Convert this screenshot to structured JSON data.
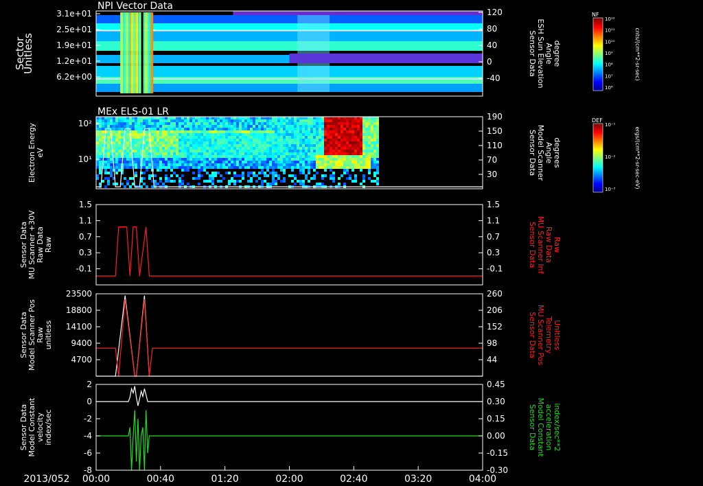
{
  "date_label": "2013/052",
  "colors": {
    "background": "#000000",
    "axis": "#ffffff",
    "red": "#ff2020",
    "green": "#22dd22"
  },
  "time_axis": {
    "start": "00:00",
    "end": "04:00",
    "ticks": [
      "00:00",
      "00:40",
      "01:20",
      "02:00",
      "02:40",
      "03:20",
      "04:00"
    ]
  },
  "panels": [
    {
      "id": "npi",
      "title": "NPI Vector Data",
      "left_label": [
        "Sector",
        "Unitless"
      ],
      "left_ticks": [
        "3.1e+01",
        "2.5e+01",
        "1.9e+01",
        "1.2e+01",
        "6.2e+00"
      ],
      "right_label": [
        "Sensor Data",
        "ESH Sun Elevation",
        "Angle",
        "degree"
      ],
      "right_ticks": [
        "120",
        "80",
        "40",
        "0",
        "-40"
      ],
      "colorbar": {
        "tag": "NF",
        "unit": "cnts/(cm**2-sr-sec)",
        "ticks": [
          "10¹²",
          "10¹¹",
          "10¹⁰",
          "10⁹",
          "10⁸",
          "10⁷",
          "10⁶"
        ]
      }
    },
    {
      "id": "els",
      "title": "MEx ELS-01 LR",
      "left_label": [
        "Electron Energy",
        "eV"
      ],
      "left_ticks": [
        "10²",
        "10¹"
      ],
      "right_label": [
        "Sensor Data",
        "Model Scanner",
        "Angle",
        "degrees"
      ],
      "right_ticks": [
        "190",
        "150",
        "110",
        "70",
        "30"
      ],
      "colorbar": {
        "tag": "DEF",
        "unit": "ergs/(cm**2-sr-sec-eV)",
        "ticks": [
          "10⁻¹",
          "10⁻²",
          "10⁻³"
        ]
      }
    },
    {
      "id": "raw",
      "left_label": [
        "Sensor Data",
        "MU Scanner +30V",
        "Raw Data",
        "Raw"
      ],
      "left_ticks": [
        "1.5",
        "1.1",
        "0.7",
        "0.3",
        "-0.1"
      ],
      "right_label": [
        "Sensor Data",
        "MU Scanner Inf",
        "Raw Data",
        "Raw"
      ],
      "right_ticks": [
        "1.5",
        "1.1",
        "0.7",
        "0.3",
        "-0.1"
      ]
    },
    {
      "id": "pos",
      "left_label": [
        "Sensor Data",
        "Model Scanner Pos",
        "Raw",
        "unitless"
      ],
      "left_ticks": [
        "23500",
        "18800",
        "14100",
        "9400",
        "4700"
      ],
      "right_label": [
        "Sensor Data",
        "MU Scanner Pos",
        "Telemetry",
        "Unitless"
      ],
      "right_ticks": [
        "260",
        "206",
        "152",
        "98",
        "44"
      ]
    },
    {
      "id": "vel",
      "left_label": [
        "Sensor Data",
        "Model Constant",
        "velocity",
        "index/sec"
      ],
      "left_ticks": [
        "2",
        "0",
        "-2",
        "-4",
        "-6",
        "-8"
      ],
      "right_label": [
        "Sensor Data",
        "Model Constant",
        "acceleration",
        "index/sec**2"
      ],
      "right_ticks": [
        "0.45",
        "0.30",
        "0.15",
        "0.00",
        "-0.15",
        "-0.30"
      ]
    }
  ],
  "chart_data": [
    {
      "type": "heatmap",
      "title": "NPI Vector Data",
      "ylabel": "Sector Unitless",
      "y2label": "Sensor Data ESH Sun Elevation Angle degree",
      "x_range": [
        "00:00",
        "04:00"
      ],
      "y_ticks": [
        31,
        25,
        19,
        12,
        6.2
      ],
      "y2_ticks": [
        120,
        80,
        40,
        0,
        -40
      ],
      "colorbar_label": "cnts/(cm**2-sr-sec)",
      "colorbar_range": [
        1000000.0,
        1000000000000.0
      ]
    },
    {
      "type": "heatmap",
      "title": "MEx ELS-01 LR",
      "ylabel": "Electron Energy eV",
      "y2label": "Sensor Data Model Scanner Angle degrees",
      "x_range": [
        "00:00",
        "04:00"
      ],
      "y_scale": "log",
      "colorbar_label": "ergs/(cm**2-sr-sec-eV)",
      "colorbar_range": [
        0.001,
        0.1
      ],
      "angle_trace": {
        "x_min": [
          0,
          3,
          6,
          9,
          12,
          15,
          18,
          21,
          24,
          27,
          30,
          33,
          36,
          60,
          120,
          180,
          240
        ],
        "y": [
          15,
          15,
          160,
          160,
          15,
          15,
          160,
          160,
          15,
          15,
          160,
          160,
          15,
          15,
          15,
          15,
          15
        ]
      }
    },
    {
      "type": "line",
      "ylabel": "Sensor Data MU Scanner +30V Raw Data Raw",
      "y2label": "Sensor Data MU Scanner Inf Raw Data Raw",
      "ylim": [
        -0.3,
        1.5
      ],
      "series": [
        {
          "color": "#ff2020",
          "x_min": [
            0,
            12,
            14,
            19,
            21,
            23,
            25,
            27,
            31,
            33,
            240
          ],
          "y": [
            -0.1,
            -0.1,
            1.0,
            1.0,
            -0.1,
            1.0,
            1.0,
            -0.1,
            1.0,
            -0.1,
            -0.1
          ]
        }
      ]
    },
    {
      "type": "line",
      "ylabel": "Sensor Data Model Scanner Pos Raw unitless",
      "y2label": "Sensor Data MU Scanner Pos Telemetry Unitless",
      "ylim": [
        0,
        23500
      ],
      "series": [
        {
          "color": "#ffffff",
          "x_min": [
            0,
            12,
            18,
            24,
            25,
            30,
            33,
            240
          ],
          "y": [
            0,
            0,
            23000,
            0,
            0,
            23000,
            0,
            0
          ]
        },
        {
          "color": "#ff2020",
          "x_min": [
            0,
            12,
            14,
            18,
            24,
            25,
            30,
            33,
            35,
            240
          ],
          "y": [
            8000,
            8000,
            0,
            22000,
            0,
            0,
            22000,
            0,
            8000,
            8000
          ]
        }
      ]
    },
    {
      "type": "line",
      "ylabel": "Sensor Data Model Constant velocity index/sec",
      "y2label": "Sensor Data Model Constant acceleration index/sec**2",
      "ylim": [
        -8,
        2
      ],
      "y2lim": [
        -0.3,
        0.45
      ],
      "series": [
        {
          "color": "#ffffff",
          "x_min": [
            0,
            20,
            21,
            22,
            23,
            24,
            25,
            26,
            27,
            28,
            29,
            30,
            31,
            32,
            33,
            240
          ],
          "y": [
            0,
            0,
            0.5,
            1.5,
            1.0,
            1.8,
            0.5,
            -0.5,
            0.3,
            1.2,
            0.6,
            1.5,
            0.8,
            0.0,
            0.0,
            0
          ]
        },
        {
          "color": "#22dd22",
          "x_min": [
            0,
            20,
            21,
            22,
            23,
            24,
            25,
            26,
            27,
            28,
            29,
            30,
            31,
            32,
            33,
            240
          ],
          "y": [
            -4,
            -4,
            -3,
            -8,
            -4,
            -1,
            -7,
            -2,
            -8,
            -4,
            -3,
            -8,
            -1,
            -6,
            -4,
            -4
          ]
        }
      ]
    }
  ]
}
